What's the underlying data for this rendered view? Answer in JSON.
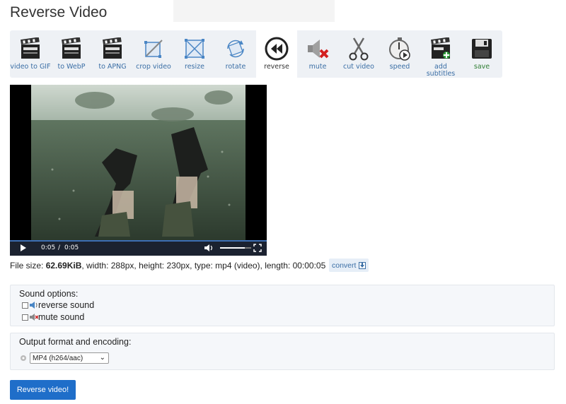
{
  "page": {
    "title": "Reverse Video"
  },
  "toolbar": {
    "items": [
      {
        "label": "video to GIF",
        "icon": "clapperboard-icon"
      },
      {
        "label": "to WebP",
        "icon": "clapperboard-icon"
      },
      {
        "label": "to APNG",
        "icon": "clapperboard-icon"
      },
      {
        "label": "crop video",
        "icon": "crop-icon"
      },
      {
        "label": "resize",
        "icon": "resize-icon"
      },
      {
        "label": "rotate",
        "icon": "rotate-icon"
      },
      {
        "label": "reverse",
        "icon": "rewind-icon",
        "active": true
      },
      {
        "label": "mute",
        "icon": "mute-speaker-icon"
      },
      {
        "label": "cut video",
        "icon": "scissors-icon"
      },
      {
        "label": "speed",
        "icon": "stopwatch-icon"
      },
      {
        "label": "add\nsubtitles",
        "icon": "clapperboard-subtitle-icon"
      },
      {
        "label": "save",
        "icon": "floppy-disk-icon"
      }
    ]
  },
  "video": {
    "current_time": "0:05",
    "separator": "/",
    "duration": "0:05",
    "progress": 1.0,
    "volume": 0.8
  },
  "file_info": {
    "prefix": "File size: ",
    "size": "62.69KiB",
    "details": ", width: 288px, height: 230px, type: mp4 (video), length: 00:00:05",
    "convert_label": "convert"
  },
  "sound_options": {
    "heading": "Sound options:",
    "reverse_label": "reverse sound",
    "mute_label": "mute sound"
  },
  "output": {
    "heading": "Output format and encoding:",
    "selected": "MP4 (h264/aac)"
  },
  "submit_label": "Reverse video!",
  "colors": {
    "accent": "#1f6ec9",
    "toolbar_bg": "#eef1f5",
    "link": "#3a6ea5"
  }
}
